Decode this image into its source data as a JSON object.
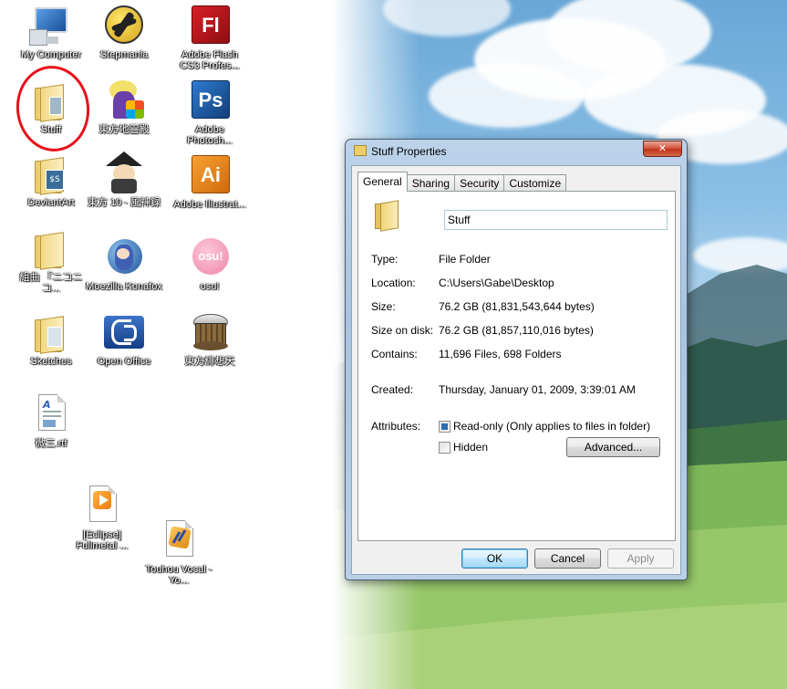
{
  "desktop": {
    "icons": [
      {
        "label": "My Computer",
        "icon": "computer-icon"
      },
      {
        "label": "Stepmania",
        "icon": "stepmania-icon"
      },
      {
        "label": "Adobe Flash CS3 Profes...",
        "icon": "flash-icon",
        "glyph": "Fl"
      },
      {
        "label": "Stuff",
        "icon": "folder-icon"
      },
      {
        "label": "東方地霊殿",
        "icon": "touhou-icon"
      },
      {
        "label": "Adobe Photosh...",
        "icon": "photoshop-icon",
        "glyph": "Ps"
      },
      {
        "label": "DeviantArt",
        "icon": "folder-icon"
      },
      {
        "label": "東方 10 - 風神録",
        "icon": "touhou-icon"
      },
      {
        "label": "Adobe Illustrat...",
        "icon": "illustrator-icon",
        "glyph": "Ai"
      },
      {
        "label": "組曲 『ニコニコ...",
        "icon": "folder-icon"
      },
      {
        "label": "Moezilla Konafox",
        "icon": "moezilla-icon"
      },
      {
        "label": "osu!",
        "icon": "osu-icon",
        "glyph": "osu!"
      },
      {
        "label": "Sketches",
        "icon": "folder-icon"
      },
      {
        "label": "Open Office",
        "icon": "openoffice-icon"
      },
      {
        "label": "東方緋想天",
        "icon": "touhou-icon"
      },
      {
        "label": "微三.rtf",
        "icon": "document-icon"
      },
      {
        "label": "[Eclipse] Fullmetal ...",
        "icon": "video-file-icon"
      },
      {
        "label": "Touhou Vocal - Yo...",
        "icon": "audio-file-icon"
      }
    ],
    "colors": {
      "highlight_circle": "#e8101a",
      "flash": "#c8141b",
      "photoshop": "#1d5fa8",
      "illustrator": "#e88416",
      "osu": "#f29cb8"
    }
  },
  "window": {
    "title": "Stuff Properties",
    "close_glyph": "✕",
    "tabs": [
      "General",
      "Sharing",
      "Security",
      "Customize"
    ],
    "active_tab": "General",
    "name_value": "Stuff",
    "properties": {
      "type_label": "Type:",
      "type_value": "File Folder",
      "location_label": "Location:",
      "location_value": "C:\\Users\\Gabe\\Desktop",
      "size_label": "Size:",
      "size_value": "76.2 GB (81,831,543,644 bytes)",
      "size_on_disk_label": "Size on disk:",
      "size_on_disk_value": "76.2 GB (81,857,110,016 bytes)",
      "contains_label": "Contains:",
      "contains_value": "11,696 Files, 698 Folders",
      "created_label": "Created:",
      "created_value": "Thursday, January 01, 2009, 3:39:01 AM",
      "attributes_label": "Attributes:"
    },
    "attributes": {
      "readonly_label": "Read-only (Only applies to files in folder)",
      "readonly_state": "indeterminate",
      "hidden_label": "Hidden",
      "hidden_state": "unchecked",
      "advanced_label": "Advanced..."
    },
    "buttons": {
      "ok": "OK",
      "cancel": "Cancel",
      "apply": "Apply"
    }
  }
}
